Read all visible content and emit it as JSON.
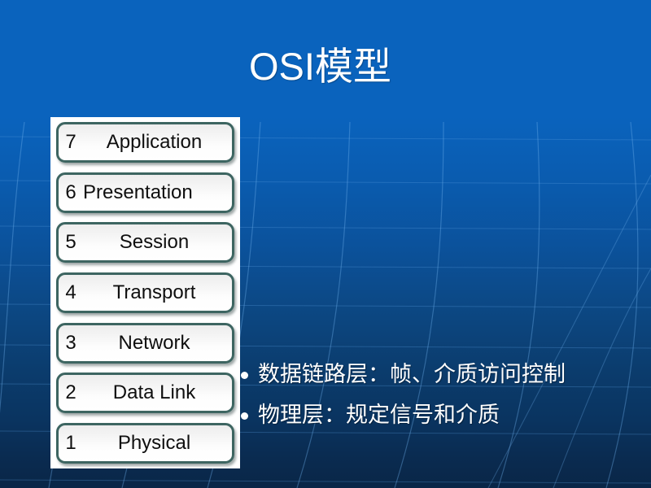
{
  "slide": {
    "title": "OSI模型",
    "background": {
      "top_color": "#0a63bd",
      "bottom_color": "#092647",
      "accent_line_color": "#5b9fe0"
    }
  },
  "osi_stack": {
    "panel_background": "#ffffff",
    "box_border_color": "#3d6561",
    "box_fill_color": "#f4f4f4",
    "layers": [
      {
        "number": "7",
        "name": "Application"
      },
      {
        "number": "6",
        "name": "Presentation"
      },
      {
        "number": "5",
        "name": "Session"
      },
      {
        "number": "4",
        "name": "Transport"
      },
      {
        "number": "3",
        "name": "Network"
      },
      {
        "number": "2",
        "name": "Data Link"
      },
      {
        "number": "1",
        "name": "Physical"
      }
    ]
  },
  "bullets": [
    {
      "text": "数据链路层：帧、介质访问控制"
    },
    {
      "text": "物理层：规定信号和介质"
    }
  ]
}
